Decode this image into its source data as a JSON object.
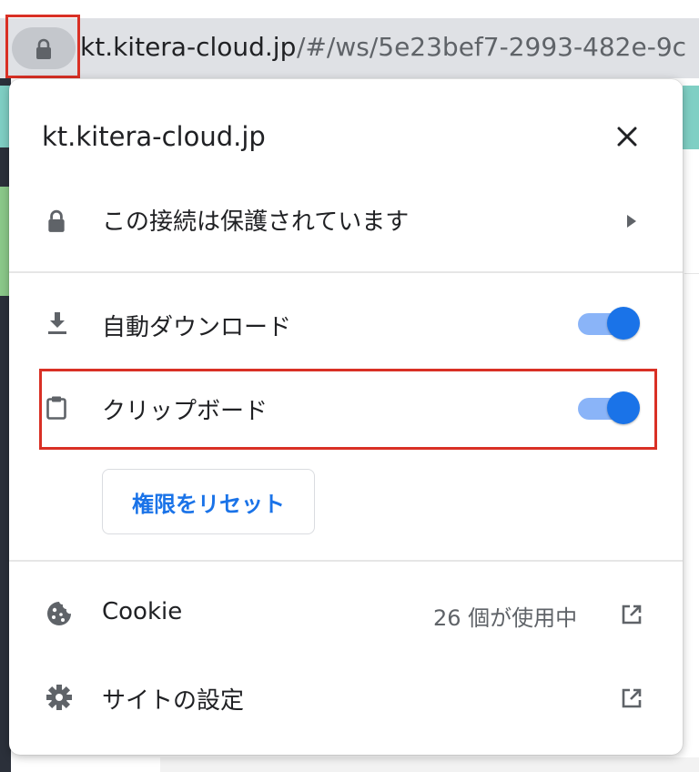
{
  "address_bar": {
    "url_host": "kt.kitera-cloud.jp",
    "url_path": "/#/ws/5e23bef7-2993-482e-9c",
    "icon": "lock-icon"
  },
  "popup": {
    "site_title": "kt.kitera-cloud.jp",
    "close_icon": "close-icon",
    "connection": {
      "label": "この接続は保護されています",
      "icon": "lock-icon",
      "chevron_icon": "chevron-right-icon"
    },
    "permissions": [
      {
        "label": "自動ダウンロード",
        "icon": "download-icon",
        "enabled": true
      },
      {
        "label": "クリップボード",
        "icon": "clipboard-icon",
        "enabled": true
      }
    ],
    "reset_button": "権限をリセット",
    "cookie": {
      "label": "Cookie",
      "status": "26 個が使用中",
      "icon": "cookie-icon",
      "external_icon": "open-external-icon"
    },
    "site_settings": {
      "label": "サイトの設定",
      "icon": "gear-icon",
      "external_icon": "open-external-icon"
    }
  },
  "colors": {
    "accent": "#1a73e8",
    "toggle_track": "#8ab4f8",
    "highlight": "#d93025"
  }
}
